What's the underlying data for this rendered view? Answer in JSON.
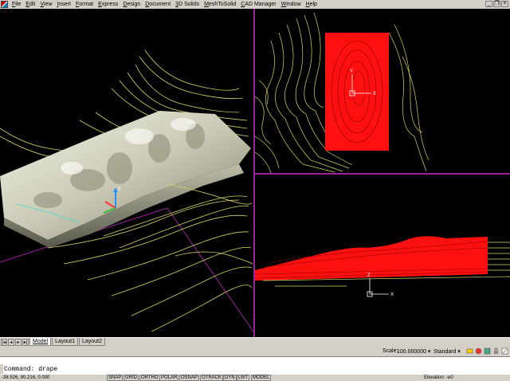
{
  "menu": {
    "items": [
      {
        "first": "F",
        "rest": "ile"
      },
      {
        "first": "E",
        "rest": "dit"
      },
      {
        "first": "V",
        "rest": "iew"
      },
      {
        "first": "I",
        "rest": "nsert"
      },
      {
        "first": "F",
        "rest": "ormat"
      },
      {
        "first": "E",
        "rest": "xpress"
      },
      {
        "first": "D",
        "rest": "esign"
      },
      {
        "first": "D",
        "rest": "ocument"
      },
      {
        "first": "3",
        "rest": "D Solids"
      },
      {
        "first": "M",
        "rest": "eshToSolid"
      },
      {
        "first": "C",
        "rest": "AD Manager"
      },
      {
        "first": "W",
        "rest": "indow"
      },
      {
        "first": "H",
        "rest": "elp"
      }
    ]
  },
  "window_controls": {
    "minimize": "_",
    "restore": "❐",
    "close": "×"
  },
  "layout_tabs": [
    "Model",
    "Layout1",
    "Layout2"
  ],
  "nav_buttons": [
    "|◂",
    "◂",
    "▸",
    "▸|"
  ],
  "scale": {
    "label": "Scale:",
    "value": "100.000000 ▾",
    "style": "Standard ▾"
  },
  "command": {
    "line1": "",
    "line2": "Command: drape"
  },
  "status": {
    "coords": "-38.526, 90.216, 0.000",
    "buttons": [
      "SNAP",
      "GRID",
      "ORTHO",
      "POLAR",
      "OSNAP",
      "OTRACK",
      "DYN",
      "LWT",
      "MODEL"
    ],
    "elevation_label": "Elevation:",
    "elevation_value": "-e0"
  },
  "colors": {
    "contour": "#d8d860",
    "mesh": "#ff1010",
    "viewport_border": "#a020a0",
    "background": "#000000"
  },
  "viewports": {
    "plan_ucs_label": "Y",
    "plan_ucs_x": "X",
    "front_ucs_label": "Z",
    "front_ucs_x": "X"
  }
}
